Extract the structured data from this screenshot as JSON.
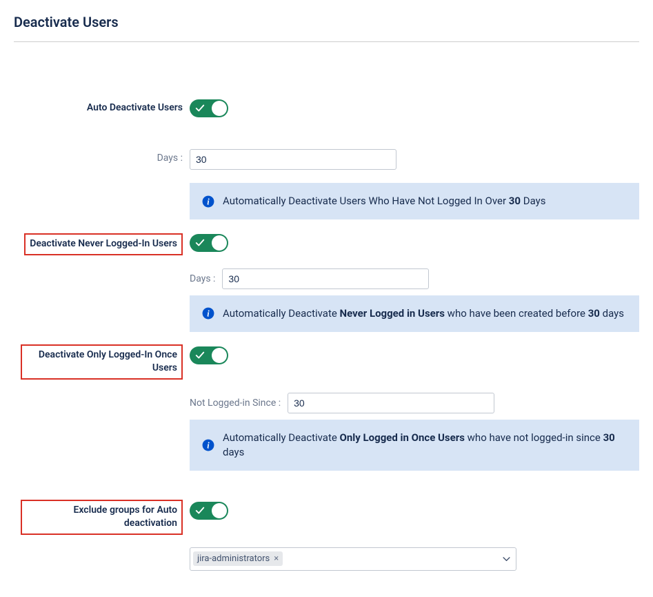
{
  "page": {
    "title": "Deactivate Users"
  },
  "fields": {
    "autoDeactivate": {
      "label": "Auto Deactivate Users"
    },
    "days1": {
      "label": "Days :",
      "value": "30"
    },
    "infoAuto": {
      "prefix": "Automatically Deactivate Users Who Have Not Logged In Over ",
      "boldPart": "30",
      "suffix": " Days"
    },
    "neverLoggedIn": {
      "label": "Deactivate Never Logged-In Users"
    },
    "days2": {
      "label": "Days :",
      "value": "30"
    },
    "infoNever": {
      "prefix": "Automatically Deactivate ",
      "boldMid": "Never Logged in Users",
      "mid": " who have been created before ",
      "boldDays": "30",
      "suffix": " days"
    },
    "onceLoggedIn": {
      "label": "Deactivate Only Logged-In Once Users"
    },
    "notLoggedSince": {
      "label": "Not Logged-in Since :",
      "value": "30"
    },
    "infoOnce": {
      "prefix": "Automatically Deactivate ",
      "boldMid": "Only Logged in Once Users",
      "mid": " who have not logged-in since ",
      "boldDays": "30",
      "suffix": " days"
    },
    "excludeGroups": {
      "label": "Exclude groups for Auto deactivation"
    },
    "groupSelect": {
      "tag": "jira-administrators"
    }
  }
}
